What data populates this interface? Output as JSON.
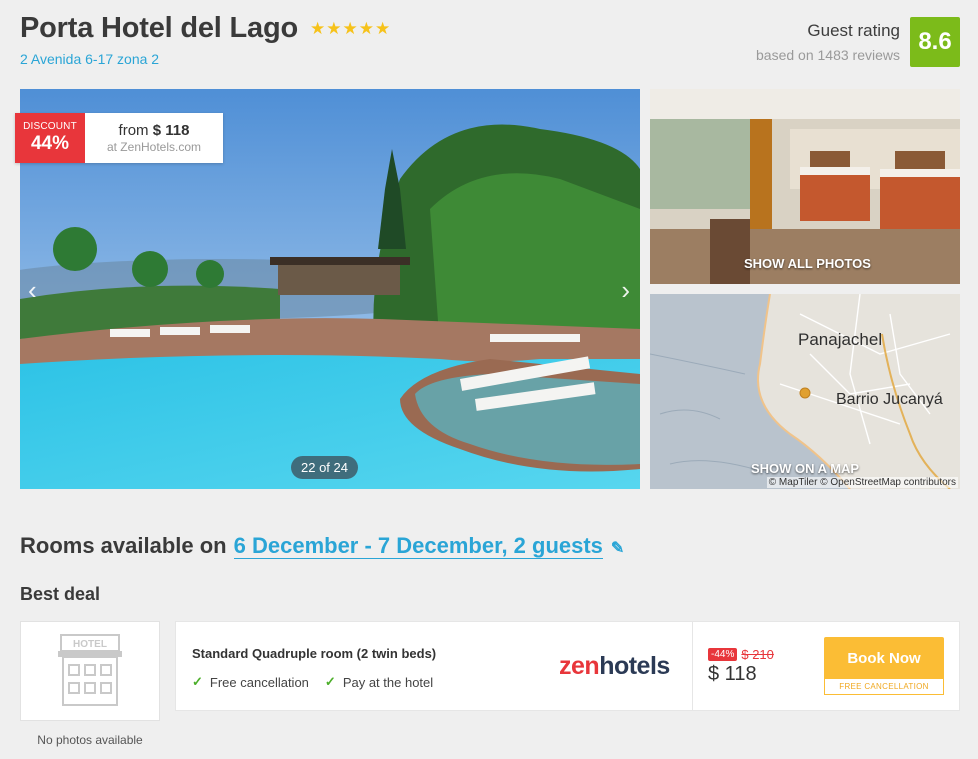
{
  "hotel": {
    "name": "Porta Hotel del Lago",
    "stars": 5,
    "address": "2 Avenida 6-17 zona 2"
  },
  "rating": {
    "label": "Guest rating",
    "reviews": "based on 1483 reviews",
    "score": "8.6",
    "color": "#7cbb1a"
  },
  "gallery": {
    "counter": "22 of 24",
    "prev_icon": "chevron-left-icon",
    "next_icon": "chevron-right-icon",
    "show_all_photos": "SHOW ALL PHOTOS"
  },
  "deal_badge": {
    "label": "DISCOUNT",
    "percent": "44%",
    "from_prefix": "from",
    "price": "$ 118",
    "site": "at ZenHotels.com"
  },
  "map": {
    "town1": "Panajachel",
    "town2": "Barrio Jucanyá",
    "show_on_map": "SHOW ON A MAP",
    "attribution": "© MapTiler © OpenStreetMap contributors"
  },
  "rooms": {
    "heading": "Rooms available on",
    "dates": "6 December - 7 December, 2 guests",
    "edit_icon": "pencil-icon",
    "best_deal": "Best deal"
  },
  "offer": {
    "no_photos": "No photos available",
    "room_name": "Standard Quadruple room (2 twin beds)",
    "features": [
      "Free cancellation",
      "Pay at the hotel"
    ],
    "provider_part1": "zen",
    "provider_part2": "hotels",
    "discount": "-44%",
    "old_price": "$ 210",
    "new_price": "$ 118",
    "book_label": "Book Now",
    "book_sub": "FREE CANCELLATION"
  },
  "colors": {
    "accent": "#2aa5d6",
    "discount_red": "#e8363b",
    "book_yellow": "#fbbd35",
    "star": "#f6c21a"
  }
}
